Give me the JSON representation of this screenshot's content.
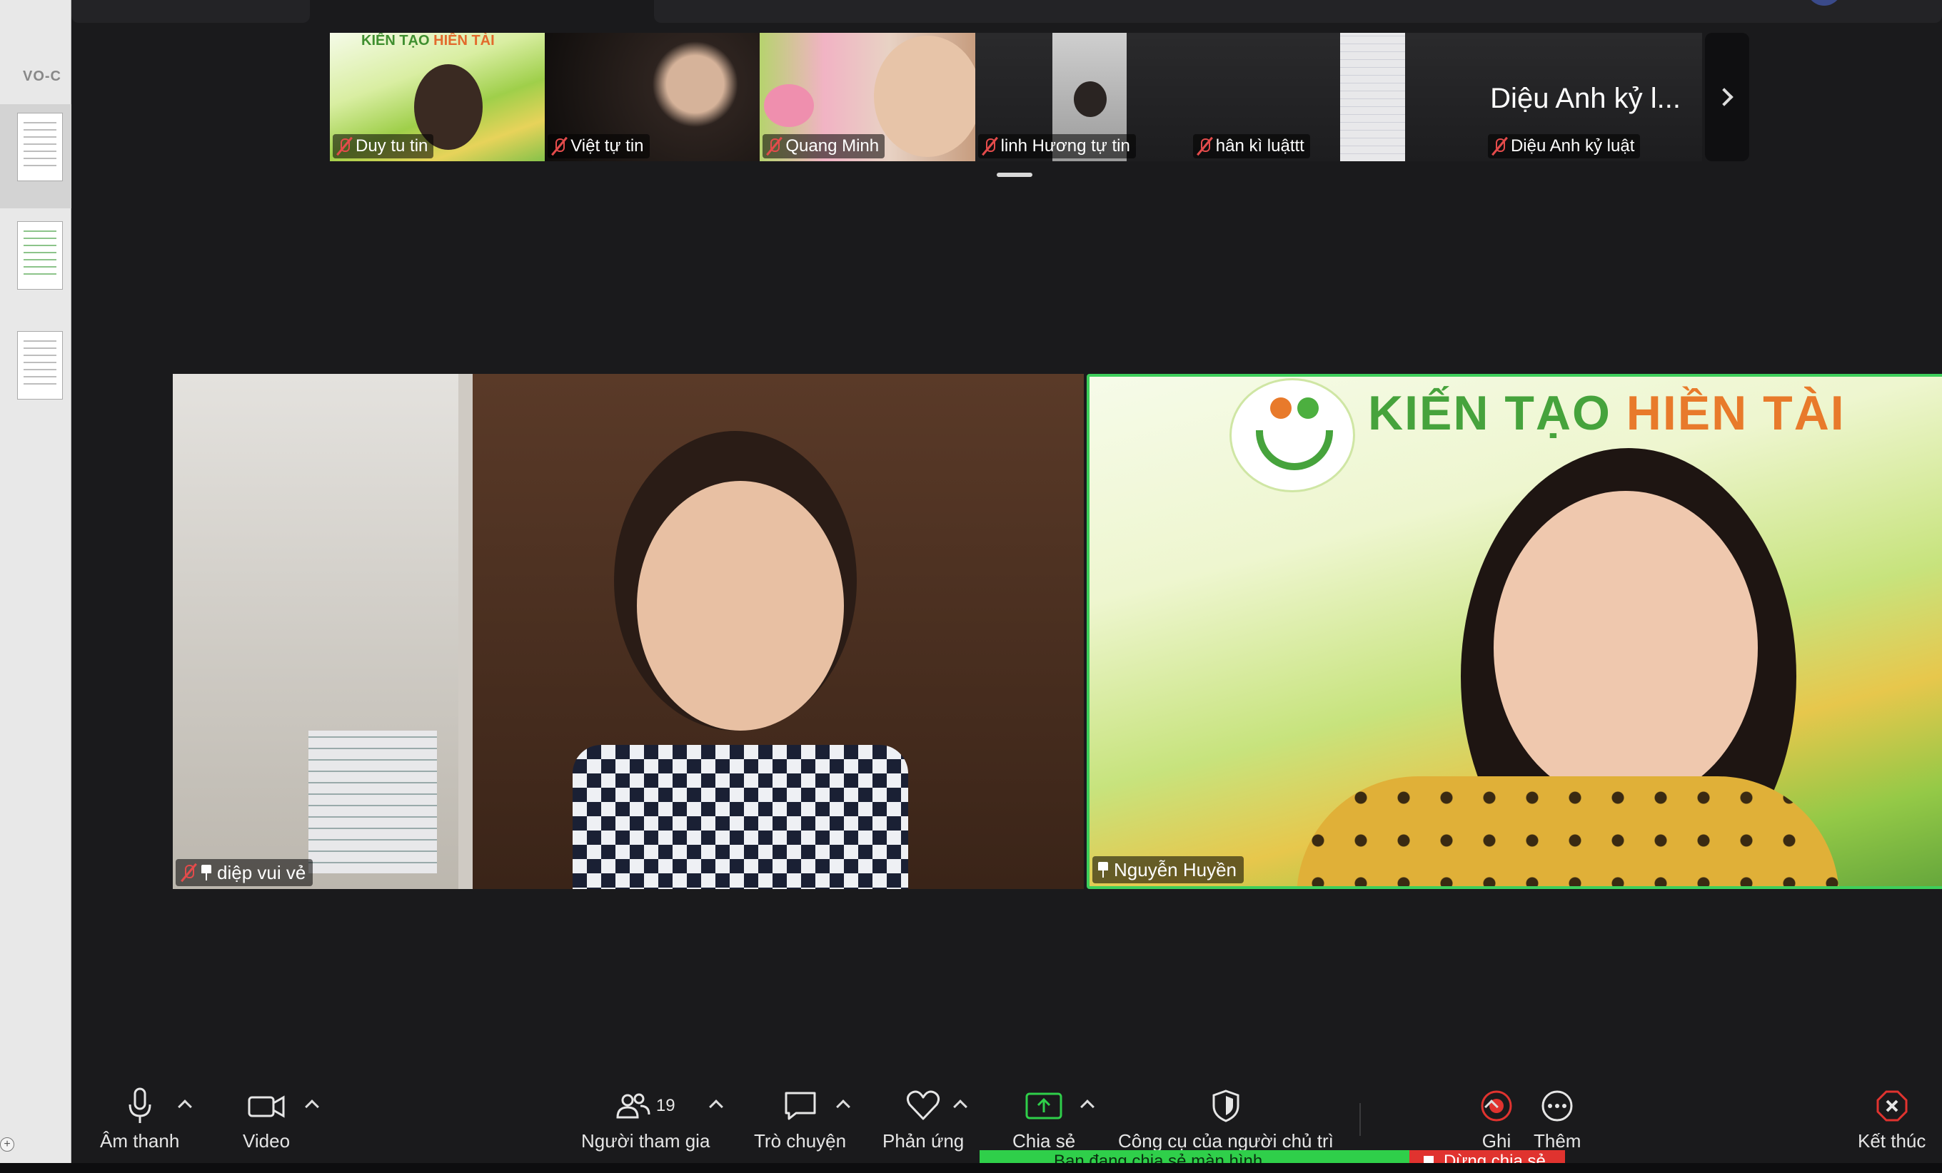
{
  "doc_sidebar": {
    "label": "VO-C"
  },
  "thumbnails": [
    {
      "name": "Duy tu tin",
      "muted": true,
      "logo_text_green": "KIẾN TẠO ",
      "logo_text_orange": "HIỀN TÀI"
    },
    {
      "name": "Việt tự tin",
      "muted": true
    },
    {
      "name": "Quang Minh",
      "muted": true
    },
    {
      "name": "linh Hương tự tin",
      "muted": true
    },
    {
      "name": "hân kì luậttt",
      "muted": true
    },
    {
      "name": "Diệu Anh kỷ luật",
      "muted": true,
      "display_name": "Diệu Anh kỷ l..."
    }
  ],
  "main_videos": {
    "left": {
      "name": "diệp vui vẻ",
      "muted": true,
      "pinned": true
    },
    "right": {
      "name": "Nguyễn Huyền",
      "pinned": true,
      "active_speaker": true,
      "banner_green": "KIẾN TẠO ",
      "banner_orange": "HIỀN TÀI"
    }
  },
  "toolbar": {
    "audio": "Âm thanh",
    "video": "Video",
    "participants": "Người tham gia",
    "participants_count": "19",
    "chat": "Trò chuyện",
    "reactions": "Phản ứng",
    "share": "Chia sẻ",
    "host_tools": "Công cụ của người chủ trì",
    "record": "Ghi",
    "more": "Thêm",
    "end": "Kết thúc"
  },
  "share_banner": {
    "status": "Bạn đang chia sẻ màn hình",
    "stop": "Dừng chia sẻ"
  },
  "colors": {
    "active_speaker_border": "#3ecf5b",
    "record_red": "#e0332f",
    "share_green": "#2fcf4a",
    "share_icon_green": "#2fcf4a",
    "end_red": "#e0332f"
  }
}
